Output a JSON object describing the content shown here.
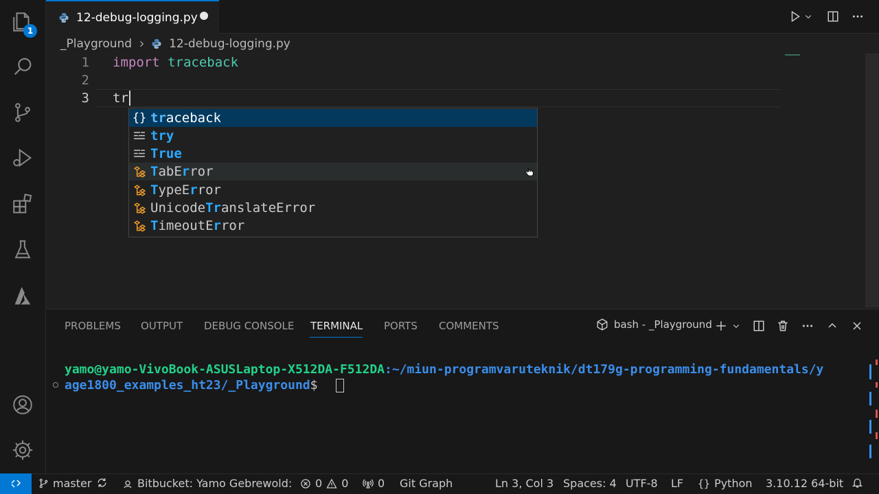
{
  "activity_bar": {
    "explorer_badge": "1",
    "items": [
      "files-icon",
      "search-icon",
      "source-control-icon",
      "run-debug-icon",
      "extensions-icon",
      "testing-icon",
      "azure-icon"
    ],
    "bottom": [
      "account-icon",
      "settings-gear-icon"
    ]
  },
  "tab": {
    "filename": "12-debug-logging.py",
    "modified": true
  },
  "breadcrumb": {
    "folder": "_Playground",
    "file": "12-debug-logging.py"
  },
  "editor": {
    "lines": [
      {
        "number": "1",
        "keyword": "import",
        "module": "traceback"
      },
      {
        "number": "2",
        "text": ""
      },
      {
        "number": "3",
        "text": "tr"
      }
    ]
  },
  "suggest": {
    "items": [
      {
        "kind": "module",
        "icon": "{}",
        "match": "tr",
        "rest": "aceback"
      },
      {
        "kind": "keyword",
        "match": "tr",
        "rest": "y"
      },
      {
        "kind": "keyword",
        "match": "Tr",
        "rest": "ue"
      },
      {
        "kind": "class",
        "pre": "",
        "m1": "T",
        "mid": "abE",
        "m2": "r",
        "post": "ror"
      },
      {
        "kind": "class",
        "pre": "",
        "m1": "T",
        "mid": "ypeE",
        "m2": "r",
        "post": "ror"
      },
      {
        "kind": "class",
        "pre": "Unicode",
        "m1": "Tr",
        "mid": "anslateError",
        "m2": "",
        "post": ""
      },
      {
        "kind": "class",
        "pre": "",
        "m1": "T",
        "mid": "imeoutE",
        "m2": "r",
        "post": "ror"
      }
    ]
  },
  "panel": {
    "tabs": [
      "PROBLEMS",
      "OUTPUT",
      "DEBUG CONSOLE",
      "TERMINAL",
      "PORTS",
      "COMMENTS"
    ],
    "active_tab": "TERMINAL",
    "terminal_name": "bash - _Playground",
    "prompt_user": "yamo@yamo-VivoBook-ASUSLaptop-X512DA-F512DA",
    "prompt_path_1": ":~/miun-programvaruteknik/dt179g-programming-fundamentals/y",
    "prompt_path_2": "age1800_examples_ht23/_Playground",
    "prompt_suffix": "$ "
  },
  "status_bar": {
    "branch": "master",
    "bitbucket": "Bitbucket: Yamo Gebrewold:",
    "errors": "0",
    "warnings": "0",
    "ports": "0",
    "git_graph": "Git Graph",
    "position": "Ln 3, Col 3",
    "spaces": "Spaces: 4",
    "encoding": "UTF-8",
    "eol": "LF",
    "language": "Python",
    "interpreter": "3.10.12 64-bit"
  },
  "colors": {
    "accent": "#0078d4",
    "keyword": "#c586c0",
    "module": "#4ec9b0",
    "terminal_user": "#23d18b",
    "terminal_path": "#3b8eea"
  }
}
